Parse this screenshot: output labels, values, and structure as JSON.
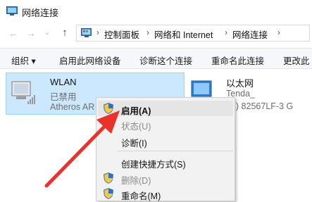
{
  "window": {
    "title": "网络连接"
  },
  "address": {
    "sep_first": "›",
    "crumbs": [
      "控制面板",
      "网络和 Internet",
      "网络连接"
    ],
    "sep": "›"
  },
  "toolbar": {
    "organize": "组织 ▾",
    "enable_device": "启用此网络设备",
    "diagnose": "诊断这个连接",
    "rename": "重命名此连接",
    "more": "更改此"
  },
  "connections": [
    {
      "name": "WLAN",
      "status": "已禁用",
      "adapter": "Atheros AR"
    },
    {
      "name": "以太网",
      "status": "Tenda_",
      "adapter": "el(R) 82567LF-3 G"
    }
  ],
  "context_menu": {
    "items": [
      {
        "label": "启用(A)",
        "enabled": true,
        "shield": true,
        "default": true
      },
      {
        "label": "状态(U)",
        "enabled": false,
        "shield": false
      },
      {
        "label": "诊断(I)",
        "enabled": true,
        "shield": false
      },
      {
        "label": "创建快捷方式(S)",
        "enabled": true,
        "shield": false
      },
      {
        "label": "删除(D)",
        "enabled": false,
        "shield": true
      },
      {
        "label": "重命名(M)",
        "enabled": true,
        "shield": true
      }
    ]
  },
  "colors": {
    "selection": "#cce8ff",
    "annotation_arrow": "#e8322b"
  },
  "icons": {
    "title": "network-connections-icon",
    "back": "back-arrow-icon",
    "forward": "forward-arrow-icon",
    "recent": "chevron-down-icon",
    "up": "up-arrow-icon",
    "address": "control-panel-icon",
    "wlan": "wireless-adapter-icon",
    "ethernet": "ethernet-adapter-icon",
    "shield": "uac-shield-icon"
  }
}
